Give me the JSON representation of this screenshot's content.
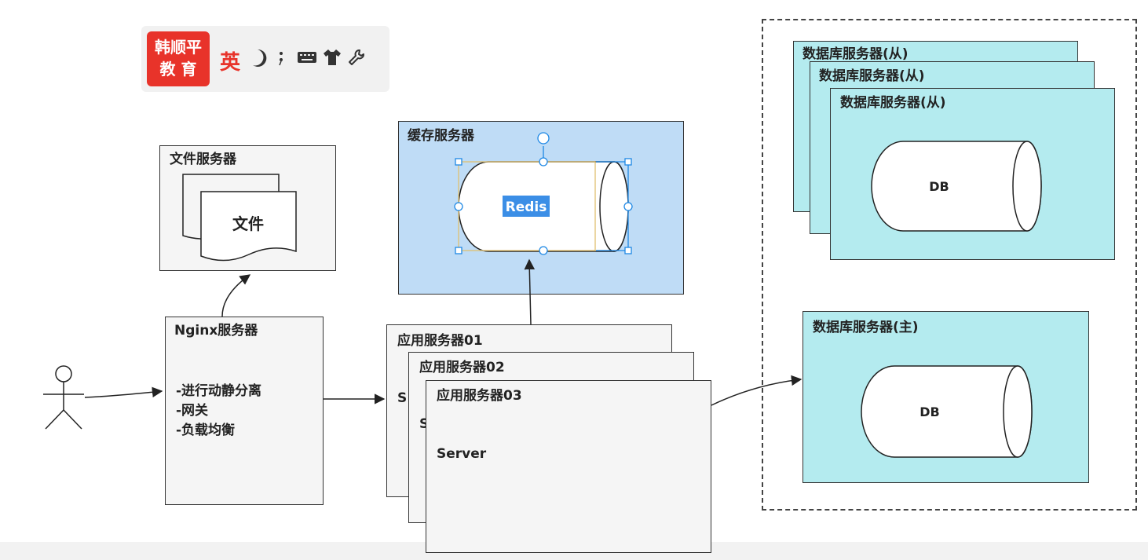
{
  "ime_toolbar": {
    "logo_line1": "韩顺平",
    "logo_line2": "教 育",
    "lang": "英",
    "icons": [
      "moon-icon",
      "punctuation-icon",
      "keyboard-icon",
      "shirt-icon",
      "wrench-icon"
    ]
  },
  "file_server": {
    "title": "文件服务器",
    "doc_label": "文件"
  },
  "cache_server": {
    "title": "缓存服务器",
    "redis_label": "Redis"
  },
  "nginx": {
    "title": "Nginx服务器",
    "lines": [
      "-进行动静分离",
      "-网关",
      "-负载均衡"
    ]
  },
  "app_servers": [
    {
      "title": "应用服务器01",
      "peek": "S"
    },
    {
      "title": "应用服务器02",
      "peek": "S"
    },
    {
      "title": "应用服务器03",
      "body": "Server"
    }
  ],
  "db_slaves": [
    {
      "title": "数据库服务器(从)"
    },
    {
      "title": "数据库服务器(从)"
    },
    {
      "title": "数据库服务器(从)",
      "db_label": "DB"
    }
  ],
  "db_master": {
    "title": "数据库服务器(主)",
    "db_label": "DB"
  },
  "colors": {
    "cache_bg": "#bfdcf6",
    "db_bg": "#b4ebef",
    "gray_bg": "#f5f5f5",
    "selection": "#1e88e5",
    "logo_red": "#e8332a"
  }
}
